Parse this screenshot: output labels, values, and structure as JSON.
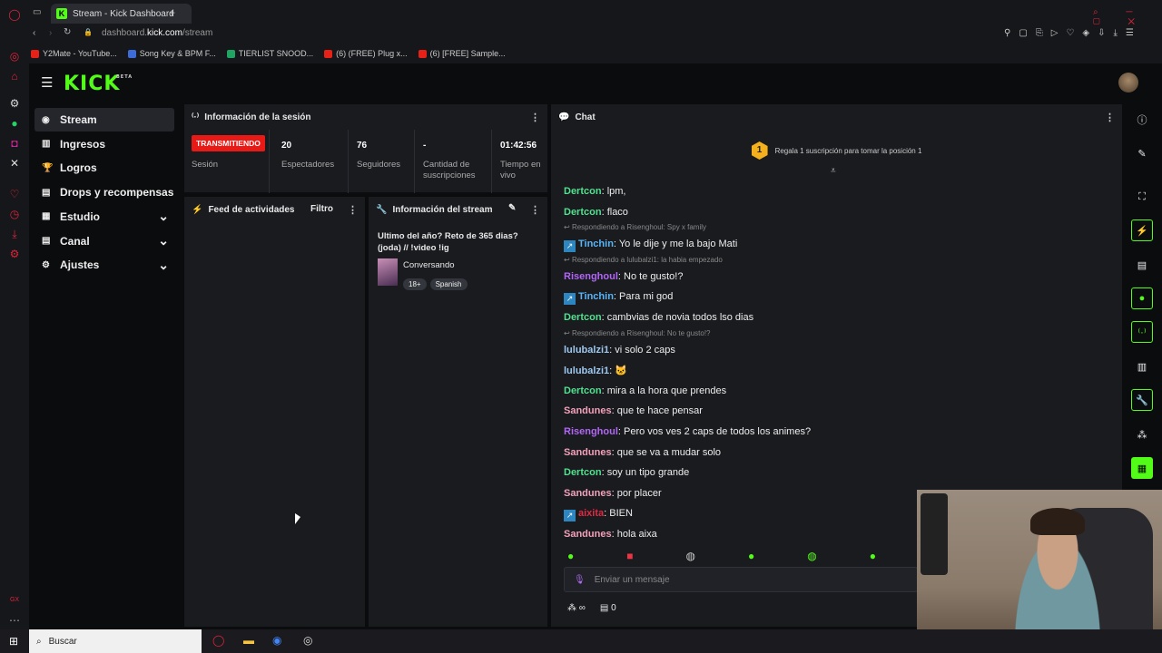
{
  "browser": {
    "tab_title": "Stream - Kick Dashboard",
    "new_tab": "+",
    "url_domain": "dashboard.",
    "url_host": "kick.com",
    "url_path": "/stream",
    "bookmarks": [
      {
        "label": "Y2Mate - YouTube...",
        "color": "#e62117"
      },
      {
        "label": "Song Key & BPM F...",
        "color": "#3d6bd8"
      },
      {
        "label": "TIERLIST SNOOD...",
        "color": "#1fa463"
      },
      {
        "label": "(6) (FREE) Plug x...",
        "color": "#e62117"
      },
      {
        "label": "(6) [FREE] Sample...",
        "color": "#e62117"
      }
    ],
    "opera_gx": "GX"
  },
  "kick": {
    "logo": "KICK",
    "beta": "BETA",
    "sidebar": [
      {
        "label": "Stream",
        "icon": "broadcast-icon",
        "glyph": "◉"
      },
      {
        "label": "Ingresos",
        "icon": "chart-icon",
        "glyph": "▥"
      },
      {
        "label": "Logros",
        "icon": "trophy-icon",
        "glyph": "🏆"
      },
      {
        "label": "Drops y recompensas",
        "icon": "gift-icon",
        "glyph": "▤"
      },
      {
        "label": "Estudio",
        "icon": "studio-icon",
        "glyph": "▦"
      },
      {
        "label": "Canal",
        "icon": "channel-icon",
        "glyph": "▤"
      },
      {
        "label": "Ajustes",
        "icon": "gear-icon",
        "glyph": "⚙"
      }
    ],
    "session": {
      "title": "Información de la sesión",
      "live_badge": "TRANSMITIENDO",
      "session_label": "Sesión",
      "viewers": "20",
      "viewers_label": "Espectadores",
      "followers": "76",
      "followers_label": "Seguidores",
      "subs": "-",
      "subs_label": "Cantidad de suscripciones",
      "time": "01:42:56",
      "time_label": "Tiempo en vivo"
    },
    "feed": {
      "title": "Feed de actividades",
      "filter": "Filtro"
    },
    "stream_info": {
      "title": "Información del stream",
      "stream_title": "Ultimo del año? Reto de 365 dias? (joda) // !video !ig",
      "category": "Conversando",
      "tags": [
        "18+",
        "Spanish"
      ]
    },
    "chat": {
      "title": "Chat",
      "gift_rank": "1",
      "gift_text": "Regala 1 suscripción para tomar la posición 1",
      "messages": [
        {
          "user": "Dertcon",
          "color": "#53e08f",
          "text": "lpm,"
        },
        {
          "user": "Dertcon",
          "color": "#53e08f",
          "text": "flaco"
        },
        {
          "reply": "Respondiendo a Risenghoul: Spy x family"
        },
        {
          "user": "Tinchin",
          "color": "#5ab4f5",
          "text": "Yo le dije y me la bajo Mati",
          "badge": true
        },
        {
          "reply": "Respondiendo a lulubalzi1: la habia empezado"
        },
        {
          "user": "Risenghoul",
          "color": "#b166f5",
          "text": "No te gusto!?"
        },
        {
          "user": "Tinchin",
          "color": "#5ab4f5",
          "text": "Para mi god",
          "badge": true
        },
        {
          "user": "Dertcon",
          "color": "#53e08f",
          "text": "cambvias de novia todos lso dias"
        },
        {
          "reply": "Respondiendo a Risenghoul: No te gusto!?"
        },
        {
          "user": "lulubalzi1",
          "color": "#9ec8f0",
          "text": "vi solo 2 caps"
        },
        {
          "user": "lulubalzi1",
          "color": "#9ec8f0",
          "text": "🐱"
        },
        {
          "user": "Dertcon",
          "color": "#53e08f",
          "text": "mira a la hora que prendes"
        },
        {
          "user": "Sandunes",
          "color": "#f2a0b8",
          "text": "que te hace pensar"
        },
        {
          "user": "Risenghoul",
          "color": "#b166f5",
          "text": "Pero vos ves 2 caps de todos los animes?"
        },
        {
          "user": "Sandunes",
          "color": "#f2a0b8",
          "text": "que se va a mudar solo"
        },
        {
          "user": "Dertcon",
          "color": "#53e08f",
          "text": "soy un tipo grande"
        },
        {
          "user": "Sandunes",
          "color": "#f2a0b8",
          "text": "por placer"
        },
        {
          "user": "aixita",
          "color": "#e02a43",
          "text": "BIEN",
          "badge": true
        },
        {
          "user": "Sandunes",
          "color": "#f2a0b8",
          "text": "hola aixa"
        }
      ],
      "input_placeholder": "Enviar un mensaje",
      "points": "∞",
      "cart_count": "0"
    }
  },
  "taskbar": {
    "search": "Buscar"
  }
}
